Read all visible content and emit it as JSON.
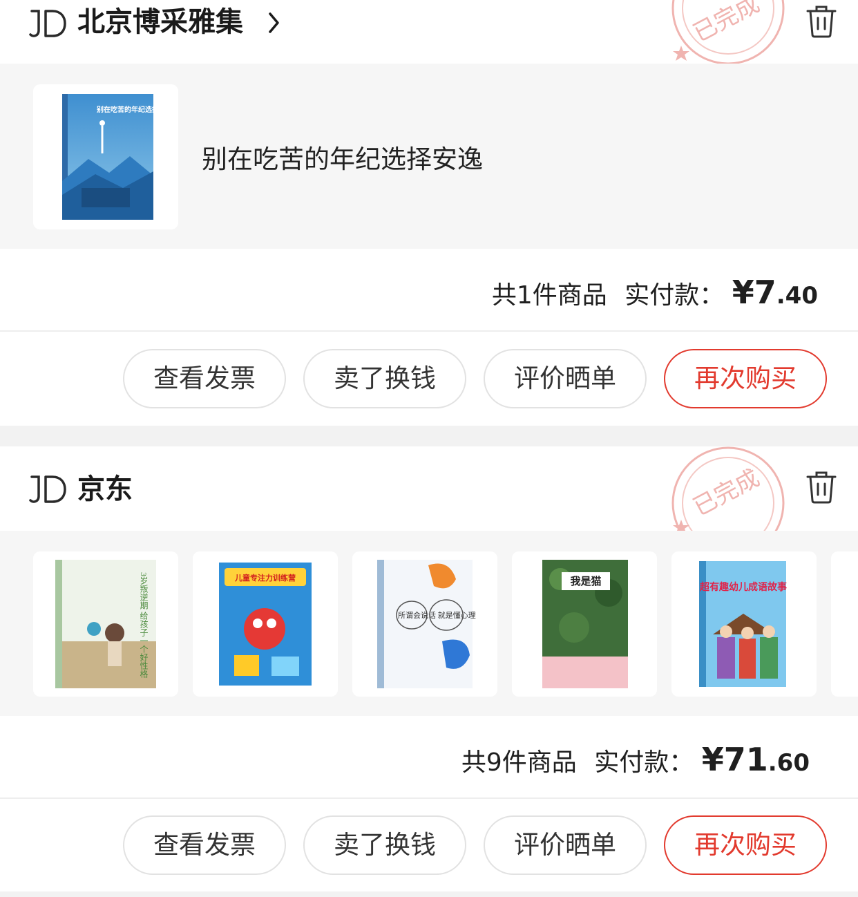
{
  "orders": [
    {
      "shop_name": "北京博采雅集",
      "has_arrow": true,
      "status_stamp": "已完成",
      "single_item_title": "别在吃苦的年纪选择安逸",
      "item_count_text": "共1件商品",
      "paid_label": "实付款：",
      "currency": "¥",
      "price_int": "7",
      "price_dec": ".40",
      "book_cover_text": "别在吃苦的年纪选择安逸",
      "buttons": [
        "查看发票",
        "卖了换钱",
        "评价晒单",
        "再次购买"
      ]
    },
    {
      "shop_name": "京东",
      "has_arrow": false,
      "status_stamp": "已完成",
      "item_count_text": "共9件商品",
      "paid_label": "实付款：",
      "currency": "¥",
      "price_int": "71",
      "price_dec": ".60",
      "books": [
        {
          "cover_title": "3岁叛逆期 给孩子一个好性格"
        },
        {
          "cover_title": "儿童专注力训练营"
        },
        {
          "cover_title": "所谓会说话 就是懂心理"
        },
        {
          "cover_title": "我是猫"
        },
        {
          "cover_title": "超有趣幼儿成语故事"
        }
      ],
      "buttons": [
        "查看发票",
        "卖了换钱",
        "评价晒单",
        "再次购买"
      ]
    }
  ],
  "colors": {
    "accent_red": "#e23a2e",
    "stamp_pink": "#f0b4b0",
    "page_bg": "#f2f2f2",
    "goods_bg": "#f6f6f6"
  },
  "icons": {
    "logo": "jd-logo",
    "arrow": "chevron-right-icon",
    "stamp": "completed-stamp",
    "delete": "trash-icon"
  }
}
